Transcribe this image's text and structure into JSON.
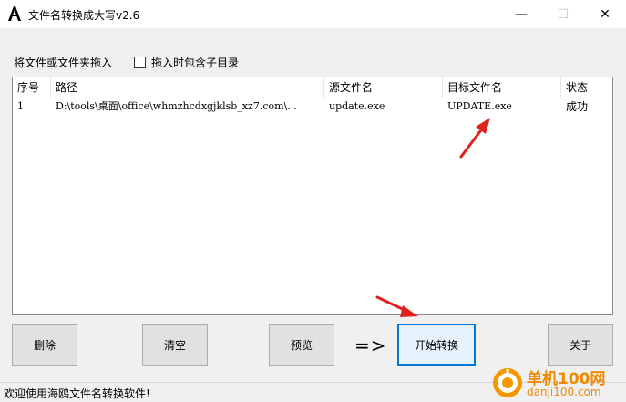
{
  "window": {
    "title": "文件名转换成大写v2.6",
    "minimize_symbol": "—",
    "maximize_symbol": "☐",
    "close_symbol": "✕"
  },
  "drop": {
    "label": "将文件或文件夹拖入",
    "include_subdirs_label": "拖入时包含子目录",
    "include_subdirs_checked": false
  },
  "table": {
    "columns": [
      "序号",
      "路径",
      "源文件名",
      "目标文件名",
      "状态"
    ],
    "rows": [
      [
        "1",
        "D:\\tools\\桌面\\office\\whmzhcdxgjklsb_xz7.com\\...",
        "update.exe",
        "UPDATE.exe",
        "成功"
      ]
    ]
  },
  "buttons": {
    "delete": "删除",
    "clear": "清空",
    "preview": "预览",
    "arrow": "=>",
    "start": "开始转换",
    "about": "关于"
  },
  "status": {
    "text": "欢迎使用海鸥文件名转换软件!"
  },
  "watermark": {
    "name": "单机100网",
    "domain": "danji100.com"
  },
  "colors": {
    "accent": "#0078d7",
    "annotation_arrow": "#e0211f",
    "watermark": "#f08a00"
  }
}
